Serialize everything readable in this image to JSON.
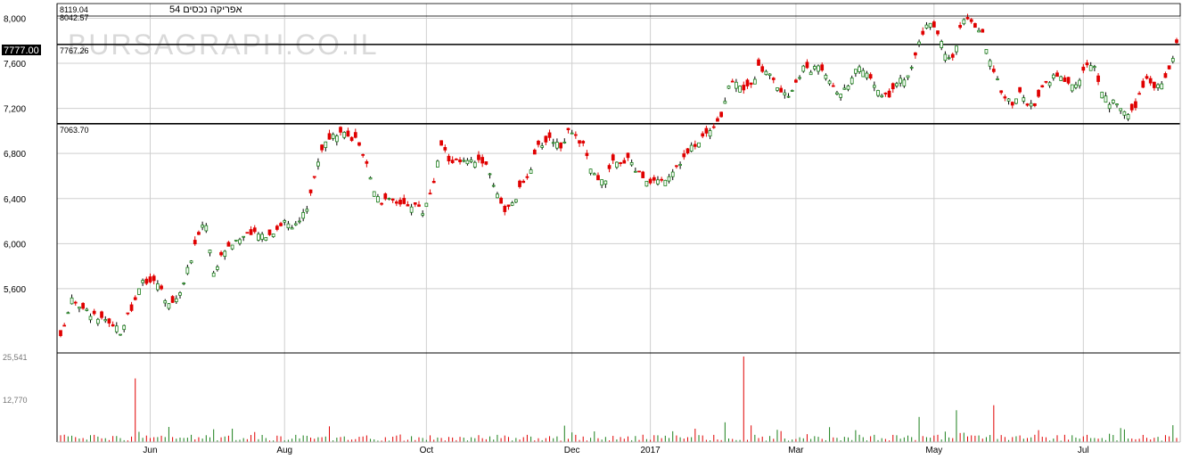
{
  "watermark": "BURSAGRAPH.CO.IL",
  "chart_data": {
    "type": "candlestick",
    "title": "אפריקה נכסים 54",
    "header_values": [
      "8119.04",
      "8042.57"
    ],
    "last_price": "7777.00",
    "y_ticks": [
      {
        "label": "8,000",
        "value": 8000
      },
      {
        "label": "7,600",
        "value": 7600
      },
      {
        "label": "7,200",
        "value": 7200
      },
      {
        "label": "6,800",
        "value": 6800
      },
      {
        "label": "6,400",
        "value": 6400
      },
      {
        "label": "6,000",
        "value": 6000
      },
      {
        "label": "5,600",
        "value": 5600
      }
    ],
    "ylim": [
      5030,
      8130
    ],
    "volume_ticks": [
      {
        "label": "25,541",
        "value": 25541
      },
      {
        "label": "12,770",
        "value": 12770
      }
    ],
    "volume_max": 25541,
    "x_tick_labels": [
      "Jun",
      "Aug",
      "Oct",
      "Dec",
      "2017",
      "Mar",
      "May",
      "Jul"
    ],
    "x_tick_index": [
      24,
      60,
      98,
      137,
      158,
      197,
      234,
      274
    ],
    "x_count": 300,
    "horizontal_lines": [
      {
        "label": "7767.26",
        "value": 7767.26
      },
      {
        "label": "7063.70",
        "value": 7063.7
      }
    ],
    "price_anchors": [
      [
        0,
        5160
      ],
      [
        3,
        5530
      ],
      [
        6,
        5420
      ],
      [
        12,
        5300
      ],
      [
        16,
        5220
      ],
      [
        20,
        5480
      ],
      [
        22,
        5680
      ],
      [
        26,
        5650
      ],
      [
        29,
        5460
      ],
      [
        31,
        5500
      ],
      [
        34,
        5760
      ],
      [
        37,
        6100
      ],
      [
        39,
        6180
      ],
      [
        41,
        5730
      ],
      [
        44,
        5960
      ],
      [
        48,
        6050
      ],
      [
        52,
        6080
      ],
      [
        56,
        6080
      ],
      [
        60,
        6200
      ],
      [
        63,
        6150
      ],
      [
        66,
        6320
      ],
      [
        68,
        6600
      ],
      [
        70,
        6850
      ],
      [
        72,
        6920
      ],
      [
        75,
        6980
      ],
      [
        77,
        6940
      ],
      [
        79,
        6920
      ],
      [
        82,
        6700
      ],
      [
        84,
        6480
      ],
      [
        86,
        6380
      ],
      [
        89,
        6380
      ],
      [
        92,
        6350
      ],
      [
        95,
        6350
      ],
      [
        97,
        6280
      ],
      [
        100,
        6550
      ],
      [
        102,
        6880
      ],
      [
        104,
        6750
      ],
      [
        107,
        6720
      ],
      [
        110,
        6720
      ],
      [
        113,
        6740
      ],
      [
        115,
        6620
      ],
      [
        117,
        6450
      ],
      [
        119,
        6300
      ],
      [
        121,
        6340
      ],
      [
        123,
        6480
      ],
      [
        126,
        6680
      ],
      [
        128,
        6860
      ],
      [
        131,
        6940
      ],
      [
        134,
        6870
      ],
      [
        136,
        6980
      ],
      [
        138,
        6940
      ],
      [
        140,
        6880
      ],
      [
        142,
        6650
      ],
      [
        144,
        6550
      ],
      [
        146,
        6580
      ],
      [
        148,
        6720
      ],
      [
        150,
        6700
      ],
      [
        152,
        6780
      ],
      [
        154,
        6660
      ],
      [
        156,
        6600
      ],
      [
        158,
        6560
      ],
      [
        161,
        6560
      ],
      [
        163,
        6620
      ],
      [
        165,
        6700
      ],
      [
        167,
        6760
      ],
      [
        169,
        6850
      ],
      [
        171,
        6920
      ],
      [
        173,
        6980
      ],
      [
        175,
        7060
      ],
      [
        177,
        7140
      ],
      [
        179,
        7400
      ],
      [
        181,
        7460
      ],
      [
        183,
        7380
      ],
      [
        185,
        7400
      ],
      [
        187,
        7560
      ],
      [
        189,
        7540
      ],
      [
        191,
        7450
      ],
      [
        193,
        7330
      ],
      [
        195,
        7300
      ],
      [
        197,
        7440
      ],
      [
        199,
        7560
      ],
      [
        201,
        7530
      ],
      [
        203,
        7600
      ],
      [
        205,
        7520
      ],
      [
        207,
        7400
      ],
      [
        209,
        7330
      ],
      [
        211,
        7380
      ],
      [
        213,
        7560
      ],
      [
        215,
        7520
      ],
      [
        217,
        7460
      ],
      [
        219,
        7360
      ],
      [
        221,
        7300
      ],
      [
        223,
        7360
      ],
      [
        225,
        7450
      ],
      [
        227,
        7470
      ],
      [
        229,
        7660
      ],
      [
        231,
        7880
      ],
      [
        233,
        7940
      ],
      [
        235,
        7880
      ],
      [
        237,
        7700
      ],
      [
        239,
        7640
      ],
      [
        241,
        7920
      ],
      [
        243,
        8000
      ],
      [
        245,
        7900
      ],
      [
        247,
        7860
      ],
      [
        249,
        7600
      ],
      [
        251,
        7440
      ],
      [
        253,
        7300
      ],
      [
        255,
        7250
      ],
      [
        257,
        7330
      ],
      [
        259,
        7250
      ],
      [
        261,
        7200
      ],
      [
        263,
        7380
      ],
      [
        265,
        7440
      ],
      [
        267,
        7500
      ],
      [
        269,
        7460
      ],
      [
        271,
        7400
      ],
      [
        273,
        7450
      ],
      [
        275,
        7600
      ],
      [
        277,
        7560
      ],
      [
        279,
        7350
      ],
      [
        281,
        7260
      ],
      [
        283,
        7240
      ],
      [
        285,
        7180
      ],
      [
        287,
        7160
      ],
      [
        289,
        7300
      ],
      [
        291,
        7440
      ],
      [
        293,
        7380
      ],
      [
        295,
        7420
      ],
      [
        297,
        7560
      ],
      [
        299,
        7777
      ]
    ]
  }
}
